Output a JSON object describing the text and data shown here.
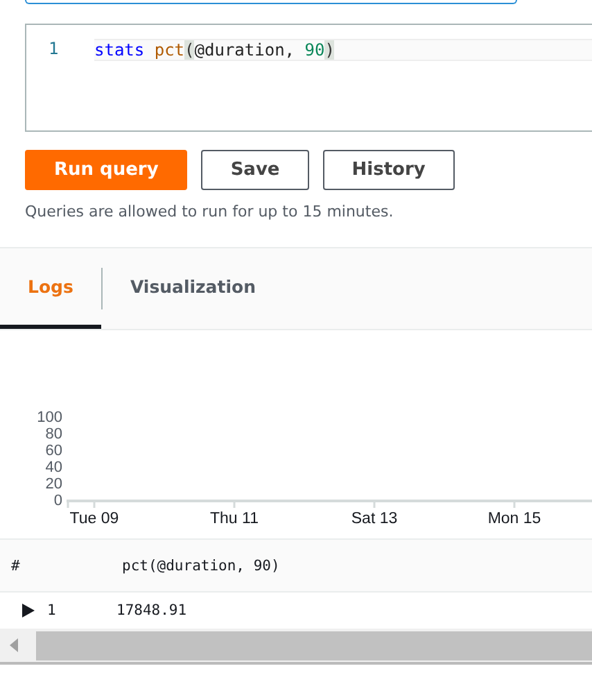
{
  "editor": {
    "line_number": "1",
    "tokens": [
      {
        "kind": "keyword",
        "text": "stats "
      },
      {
        "kind": "function",
        "text": "pct"
      },
      {
        "kind": "bracket",
        "text": "("
      },
      {
        "kind": "plain",
        "text": "@duration, "
      },
      {
        "kind": "number",
        "text": "90"
      },
      {
        "kind": "bracket",
        "text": ")"
      }
    ]
  },
  "buttons": [
    {
      "label": "Run query",
      "kind": "primary"
    },
    {
      "label": "Save",
      "kind": "normal"
    },
    {
      "label": "History",
      "kind": "normal"
    }
  ],
  "note": "Queries are allowed to run for up to 15 minutes.",
  "tabs": [
    {
      "label": "Logs",
      "selected": true
    },
    {
      "label": "Visualization",
      "selected": false
    }
  ],
  "chart": {
    "chart_data": {
      "type": "line",
      "categories": [
        "Tue 09",
        "Thu 11",
        "Sat 13",
        "Mon 15"
      ],
      "ylim": [
        0,
        100
      ],
      "yticks": [
        0,
        20,
        40,
        60,
        80,
        100
      ]
    }
  },
  "table": {
    "columns": [
      "#",
      "pct(@duration, 90)"
    ],
    "rows": [
      {
        "expanded": false,
        "cells": [
          "1",
          "17848.91"
        ]
      }
    ]
  }
}
